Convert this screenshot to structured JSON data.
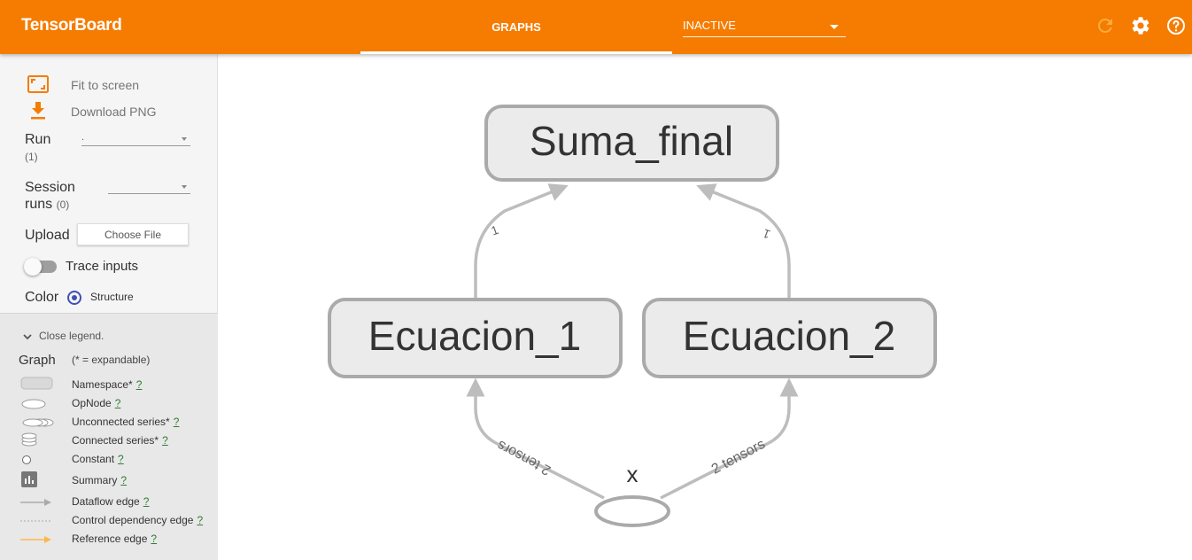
{
  "app": {
    "title": "TensorBoard"
  },
  "header": {
    "tab_label": "GRAPHS",
    "dashboard_select": "INACTIVE"
  },
  "icons": {
    "reload": "reload-icon",
    "settings": "gear-icon",
    "help": "help-icon"
  },
  "colors": {
    "accent": "#f57c00",
    "radio": "#3f51b5",
    "edge": "#bdbdbd",
    "node_fill": "#e8e8e8",
    "node_stroke": "#a8a8a8"
  },
  "sidebar": {
    "fit_label": "Fit to screen",
    "download_label": "Download PNG",
    "run_label": "Run",
    "run_count": "(1)",
    "run_value": ".",
    "session_label_1": "Session",
    "session_label_2": "runs",
    "session_count": "(0)",
    "session_value": "",
    "upload_label": "Upload",
    "choose_file": "Choose File",
    "trace_label": "Trace inputs",
    "trace_on": false,
    "color_label": "Color",
    "color_option": "Structure"
  },
  "legend": {
    "toggle": "Close legend.",
    "title": "Graph",
    "note": "(* = expandable)",
    "help_mark": "?",
    "items": [
      "Namespace*",
      "OpNode",
      "Unconnected series*",
      "Connected series*",
      "Constant",
      "Summary",
      "Dataflow edge",
      "Control dependency edge",
      "Reference edge"
    ]
  },
  "graph": {
    "nodes": {
      "top": "Suma_final",
      "left": "Ecuacion_1",
      "right": "Ecuacion_2",
      "input": "x"
    },
    "edge_labels": {
      "left_in": "2 tensors",
      "right_in": "2 tensors",
      "left_out": "1",
      "right_out": "1"
    }
  }
}
